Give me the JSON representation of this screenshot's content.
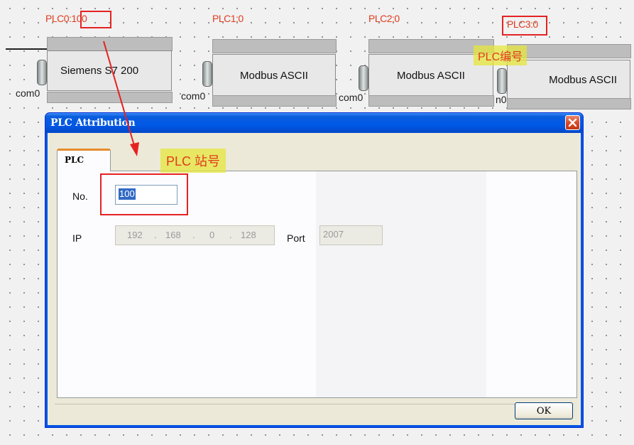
{
  "canvas": {
    "nodes": [
      {
        "plc_label": "PLC0:100",
        "device": "Siemens S7 200",
        "com": "com0"
      },
      {
        "plc_label": "PLC1:0",
        "device": "Modbus ASCII",
        "com": "com0"
      },
      {
        "plc_label": "PLC2:0",
        "device": "Modbus ASCII",
        "com": "com0"
      },
      {
        "plc_label": "PLC3:0",
        "device": "Modbus ASCII",
        "com": "n0"
      }
    ]
  },
  "annotations": {
    "plc_number": "PLC编号",
    "plc_station": "PLC 站号"
  },
  "dialog": {
    "title": "PLC Attribution",
    "close_icon": "close-icon",
    "tab_label": "PLC",
    "no_label": "No.",
    "no_value": "100",
    "ip_label": "IP",
    "ip_parts": [
      "192",
      "168",
      "0",
      "128"
    ],
    "port_label": "Port",
    "port_value": "2007",
    "ok_label": "OK"
  },
  "colors": {
    "annotation_red": "#e52222",
    "label_red": "#e03c1e",
    "title_blue": "#0058e6"
  }
}
